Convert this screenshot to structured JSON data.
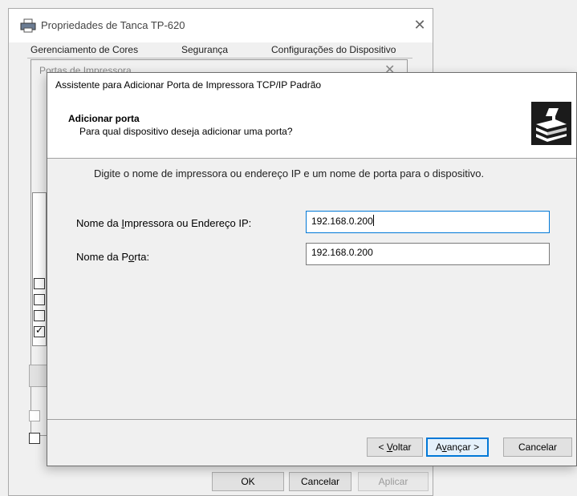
{
  "back_window": {
    "title": "Propriedades de Tanca TP-620",
    "tabs": [
      "Gerenciamento de Cores",
      "Segurança",
      "Configurações do Dispositivo"
    ],
    "buttons": {
      "ok": "OK",
      "cancel": "Cancelar",
      "apply": "Aplicar"
    }
  },
  "mid_window": {
    "title": "Portas de Impressora"
  },
  "wizard": {
    "title": "Assistente para Adicionar Porta de Impressora TCP/IP Padrão",
    "header_title": "Adicionar porta",
    "header_subtitle": "Para qual dispositivo deseja adicionar uma porta?",
    "instruction": "Digite o nome de impressora ou endereço IP e um nome de porta para o dispositivo.",
    "printer_label_pre": "Nome da ",
    "printer_label_key": "I",
    "printer_label_post": "mpressora ou Endereço IP:",
    "printer_value": "192.168.0.200",
    "port_label_pre": "Nome da P",
    "port_label_key": "o",
    "port_label_post": "rta:",
    "port_value": "192.168.0.200",
    "back_label_pre": "< ",
    "back_label_key": "V",
    "back_label_post": "oltar",
    "next_label_pre": "A",
    "next_label_key": "v",
    "next_label_post": "ançar >",
    "cancel_label": "Cancelar"
  },
  "icons": {
    "window_icon": "printer-icon",
    "wizard_icon": "network-printer-icon"
  }
}
